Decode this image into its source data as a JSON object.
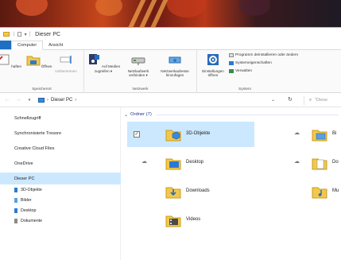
{
  "window": {
    "title": "Dieser PC"
  },
  "ribbon": {
    "tabs": [
      "Computer",
      "Ansicht"
    ],
    "buttons": [
      {
        "label": "haften",
        "icon": "properties-icon"
      },
      {
        "label": "Öffnen",
        "icon": "open-icon"
      },
      {
        "label": "Umbenennen",
        "icon": "rename-icon"
      },
      {
        "label": "Auf Medien zugreifen ▾",
        "icon": "media-icon"
      },
      {
        "label": "Netzlaufwerk verbinden ▾",
        "icon": "network-drive-icon"
      },
      {
        "label": "Netzwerkadresse hinzufügen",
        "icon": "network-location-icon"
      },
      {
        "label": "Einstellungen öffnen",
        "icon": "settings-icon"
      }
    ],
    "group_labels": [
      "Speicherort",
      "Netzwerk",
      "System"
    ],
    "system_items": [
      "Programm deinstallieren oder ändern",
      "Systemeigenschaften",
      "Verwalten"
    ]
  },
  "address": {
    "path": "Dieser PC",
    "separator": "›",
    "search_placeholder": "\"Diese"
  },
  "sidebar": {
    "items": [
      {
        "label": "Schnellzugriff"
      },
      {
        "label": "Synchronisierte Tresore"
      },
      {
        "label": "Creative Cloud Files"
      },
      {
        "label": "OneDrive"
      },
      {
        "label": "Dieser PC"
      }
    ],
    "subitems": [
      {
        "label": "3D-Objekte",
        "color": "#2a7ad5"
      },
      {
        "label": "Bilder",
        "color": "#5aa0e0"
      },
      {
        "label": "Desktop",
        "color": "#2a7ad5"
      },
      {
        "label": "Dokumente",
        "color": "#8a8a8a"
      }
    ]
  },
  "content": {
    "group_header": "Ordner (7)",
    "folders": [
      {
        "name": "3D-Objekte",
        "icon": "3d-objects-folder-icon"
      },
      {
        "name": "Bi",
        "icon": "pictures-folder-icon"
      },
      {
        "name": "Desktop",
        "icon": "desktop-folder-icon"
      },
      {
        "name": "Do",
        "icon": "documents-folder-icon"
      },
      {
        "name": "Downloads",
        "icon": "downloads-folder-icon"
      },
      {
        "name": "Mu",
        "icon": "music-folder-icon"
      },
      {
        "name": "Videos",
        "icon": "videos-folder-icon"
      }
    ]
  },
  "colors": {
    "accent": "#1d6fc3",
    "selection": "#cce8ff",
    "folder_yellow": "#f3c84a"
  }
}
